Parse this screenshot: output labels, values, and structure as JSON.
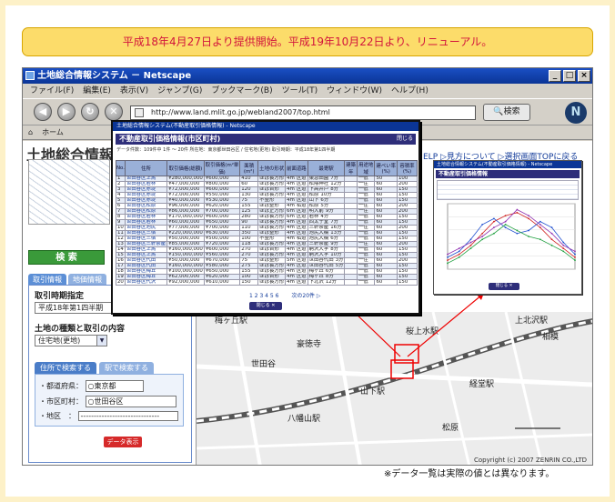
{
  "banner": {
    "text": "平成18年4月27日より提供開始。平成19年10月22日より、リニューアル。"
  },
  "browser": {
    "title": "土地総合情報システム － Netscape",
    "menu": [
      "ファイル(F)",
      "編集(E)",
      "表示(V)",
      "ジャンプ(G)",
      "ブックマーク(B)",
      "ツール(T)",
      "ウィンドウ(W)",
      "ヘルプ(H)"
    ],
    "url": "http://www.land.mlit.go.jp/webland2007/top.html",
    "search_label": "検索",
    "logo": "N",
    "tab_home": "ホーム"
  },
  "site": {
    "title": "土地総合情報",
    "links": "ELP ▷見方について  ▷選択画面TOPに戻る",
    "search_button": "検 索",
    "left_tabs": [
      "取引情報",
      "地価情報"
    ],
    "period_label": "取引時期指定",
    "period_value": "平成18年第1四半期",
    "type_label": "土地の種類と取引の内容",
    "type_value": "住宅地(更地)",
    "search_tabs": [
      "住所で検索する",
      "駅で検索する"
    ],
    "pref_label": "・都道府県：",
    "pref_value": "○東京都",
    "city_label": "・市区町村：",
    "city_value": "○世田谷区",
    "area_label": "・地区　：",
    "area_value": "------------------------------",
    "display_button": "データ表示"
  },
  "map": {
    "labels": [
      "梅ヶ丘駅",
      "豪徳寺",
      "山下駅",
      "経堂駅",
      "相模",
      "桜上水駅",
      "上北沢駅",
      "八幡山駅",
      "世田谷",
      "松原"
    ],
    "copyright": "Copyright (c) 2007 ZENRIN CO.,LTD"
  },
  "popup1": {
    "window_title": "土地総合情報システム(不動産取引価格情報) - Netscape",
    "header": "不動産取引価格情報(市区町村)",
    "close": "閉じる",
    "sub": "データ件数：109件中 1件 〜 20件 所在地：東京都世田谷区 / 住宅地(更地) 取引時期：平成18年第1四半期",
    "columns": [
      "No.",
      "住所",
      "取引価格(総額)",
      "取引価格(m²単価)",
      "面積(m²)",
      "土地の形状",
      "前面道路",
      "最寄駅",
      "建築年",
      "用途地域",
      "建ぺい率(%)",
      "容積率(%)"
    ],
    "rows": [
      [
        "1",
        "世田谷区上馬",
        "¥280,000,000",
        "¥600,000",
        "410",
        "ほぼ長方形",
        "4m",
        "区道",
        "東急田園",
        "7分",
        "一低",
        "50",
        "100"
      ],
      [
        "2",
        "世田谷区若林",
        "¥47,000,000",
        "¥800,000",
        "60",
        "ほぼ長方形",
        "4m",
        "区道",
        "松陰神社",
        "12分",
        "一住",
        "60",
        "200"
      ],
      [
        "3",
        "世田谷区赤堤",
        "¥72,000,000",
        "¥600,000",
        "120",
        "ほぼ台形",
        "4m",
        "区道",
        "下高井戸",
        "8分",
        "一低",
        "60",
        "150"
      ],
      [
        "4",
        "世田谷区赤堤",
        "¥72,000,000",
        "¥550,000",
        "130",
        "ほぼ長方形",
        "4m",
        "区道",
        "松原",
        "10分",
        "一低",
        "60",
        "150"
      ],
      [
        "5",
        "世田谷区赤堤",
        "¥40,000,000",
        "¥530,000",
        "75",
        "不整形",
        "4m",
        "区道",
        "山下",
        "6分",
        "一低",
        "60",
        "150"
      ],
      [
        "6",
        "世田谷区松原",
        "¥96,000,000",
        "¥620,000",
        "155",
        "ほぼ整形",
        "4m",
        "私道",
        "松原",
        "5分",
        "一住",
        "60",
        "200"
      ],
      [
        "7",
        "世田谷区松原",
        "¥86,000,000",
        "¥700,000",
        "125",
        "ほぼ正方形",
        "6m",
        "区道",
        "明大前",
        "9分",
        "一住",
        "60",
        "200"
      ],
      [
        "8",
        "世田谷区若林",
        "¥170,000,000",
        "¥600,000",
        "280",
        "ほぼ長方形",
        "6m",
        "区道",
        "若林",
        "4分",
        "一低",
        "60",
        "150"
      ],
      [
        "9",
        "世田谷区若林",
        "¥60,000,000",
        "¥650,000",
        "90",
        "ほぼ長方形",
        "4m",
        "区道",
        "西太子堂",
        "7分",
        "一低",
        "60",
        "150"
      ],
      [
        "10",
        "世田谷区池尻",
        "¥77,000,000",
        "¥700,000",
        "110",
        "ほぼ長方形",
        "4m",
        "区道",
        "三軒茶屋",
        "16分",
        "一住",
        "60",
        "200"
      ],
      [
        "11",
        "世田谷区三宿",
        "¥220,000,000",
        "¥630,000",
        "350",
        "ほぼ整形",
        "4m",
        "区道",
        "池尻大橋",
        "13分",
        "一低",
        "60",
        "150"
      ],
      [
        "12",
        "世田谷区三宿",
        "¥50,000,000",
        "¥500,000",
        "100",
        "不整形",
        "4m",
        "私道",
        "池尻大橋",
        "6分",
        "一低",
        "60",
        "150"
      ],
      [
        "13",
        "世田谷区三軒茶屋",
        "¥85,000,000",
        "¥720,000",
        "118",
        "ほぼ長方形",
        "4m",
        "区道",
        "三軒茶屋",
        "9分",
        "一住",
        "60",
        "200"
      ],
      [
        "14",
        "世田谷区上馬",
        "¥160,000,000",
        "¥600,000",
        "270",
        "ほぼ台形",
        "4m",
        "区道",
        "駒沢大学",
        "8分",
        "一低",
        "60",
        "150"
      ],
      [
        "15",
        "世田谷区上馬",
        "¥150,000,000",
        "¥560,000",
        "270",
        "ほぼ長方形",
        "4m",
        "区道",
        "駒沢大学",
        "10分",
        "一低",
        "60",
        "150"
      ],
      [
        "16",
        "世田谷区代田",
        "¥50,000,000",
        "¥670,000",
        "75",
        "ほぼ整形",
        "5m",
        "区道",
        "世田谷代田",
        "3分",
        "一住",
        "60",
        "200"
      ],
      [
        "17",
        "世田谷区代田",
        "¥160,000,000",
        "¥580,000",
        "275",
        "ほぼ長方形",
        "4m",
        "区道",
        "世田谷代田",
        "5分",
        "一低",
        "60",
        "150"
      ],
      [
        "18",
        "世田谷区梅丘",
        "¥100,000,000",
        "¥650,000",
        "155",
        "ほぼ長方形",
        "4m",
        "区道",
        "梅ヶ丘",
        "6分",
        "一低",
        "60",
        "150"
      ],
      [
        "19",
        "世田谷区梅丘",
        "¥62,000,000",
        "¥620,000",
        "100",
        "ほぼ台形",
        "4m",
        "区道",
        "梅ヶ丘",
        "8分",
        "一低",
        "60",
        "150"
      ],
      [
        "20",
        "世田谷区代沢",
        "¥92,000,000",
        "¥610,000",
        "150",
        "ほぼ長方形",
        "4m",
        "区道",
        "下北沢",
        "12分",
        "一低",
        "60",
        "150"
      ]
    ],
    "pager": "1 2 3 4 5 6",
    "next": "次の20件 ▷",
    "close_button": "閉じる ✕"
  },
  "popup2": {
    "window_title": "土地総合情報システム(不動産取引価格情報) - Netscape",
    "header": "不動産取引価格情報",
    "close_button": "閉じる ✕"
  },
  "chart_data": {
    "type": "line",
    "categories": [
      "1",
      "2",
      "3",
      "4",
      "5",
      "6",
      "7",
      "8",
      "9",
      "10",
      "11",
      "12"
    ],
    "series": [
      {
        "values": [
          15,
          25,
          40,
          60,
          80,
          90,
          95,
          85,
          70,
          50,
          35,
          20
        ]
      },
      {
        "values": [
          20,
          30,
          50,
          75,
          85,
          70,
          60,
          65,
          80,
          70,
          45,
          25
        ]
      },
      {
        "values": [
          10,
          20,
          35,
          50,
          60,
          75,
          65,
          55,
          50,
          40,
          30,
          15
        ]
      },
      {
        "values": [
          25,
          35,
          45,
          55,
          70,
          80,
          100,
          90,
          75,
          60,
          40,
          30
        ]
      }
    ],
    "colors": [
      "#d02020",
      "#2050d0",
      "#20a040",
      "#9030b0"
    ],
    "ylim": [
      0,
      110
    ]
  },
  "note": "※データ一覧は実際の値とは異なります。"
}
